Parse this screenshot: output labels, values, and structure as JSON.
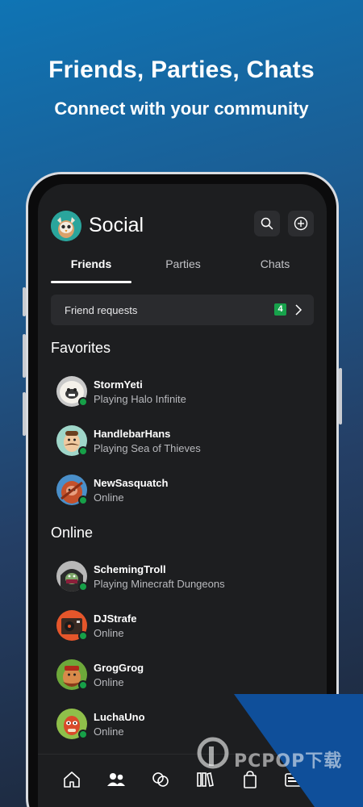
{
  "promo": {
    "title": "Friends, Parties, Chats",
    "subtitle": "Connect with your community"
  },
  "header": {
    "title": "Social",
    "search_icon": "search-icon",
    "add_icon": "add-circle-icon"
  },
  "tabs": [
    {
      "label": "Friends",
      "active": true
    },
    {
      "label": "Parties",
      "active": false
    },
    {
      "label": "Chats",
      "active": false
    }
  ],
  "friend_requests": {
    "label": "Friend requests",
    "count": "4"
  },
  "favorites": {
    "title": "Favorites",
    "items": [
      {
        "name": "StormYeti",
        "status": "Playing Halo Infinite"
      },
      {
        "name": "HandlebarHans",
        "status": "Playing Sea of Thieves"
      },
      {
        "name": "NewSasquatch",
        "status": "Online"
      }
    ]
  },
  "online": {
    "title": "Online",
    "items": [
      {
        "name": "SchemingTroll",
        "status": "Playing Minecraft Dungeons"
      },
      {
        "name": "DJStrafe",
        "status": "Online"
      },
      {
        "name": "GrogGrog",
        "status": "Online"
      },
      {
        "name": "LuchaUno",
        "status": "Online"
      }
    ]
  },
  "bottom_nav": [
    "home-icon",
    "friends-icon",
    "xbox-cloud-icon",
    "library-icon",
    "store-icon",
    "game-pass-icon"
  ],
  "watermark": {
    "text": "PCPOP下载"
  },
  "colors": {
    "accent_green": "#16a048",
    "surface": "#1d1e20",
    "card": "#2a2b2e"
  }
}
